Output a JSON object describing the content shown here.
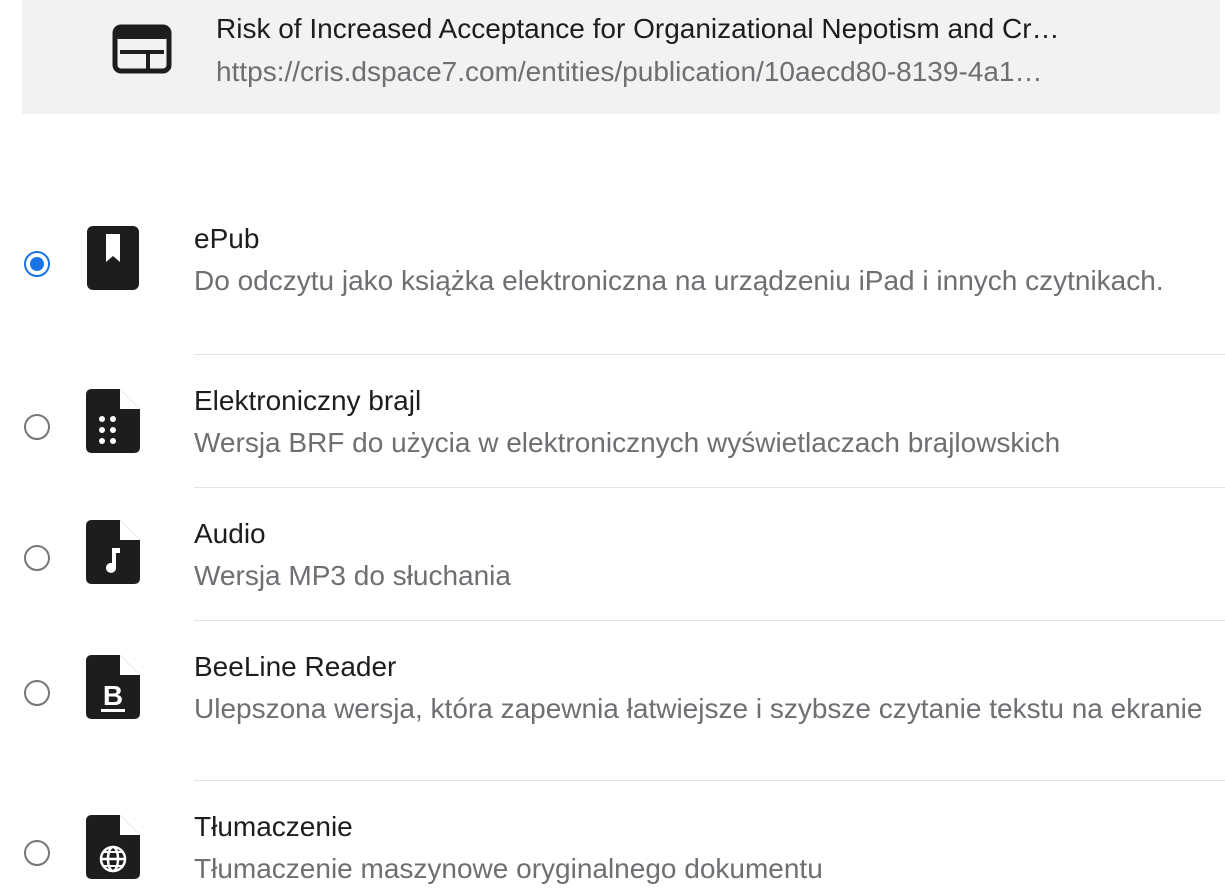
{
  "source": {
    "title": "Risk of Increased Acceptance for Organizational Nepotism and Cr…",
    "url": "https://cris.dspace7.com/entities/publication/10aecd80-8139-4a1…",
    "icon": "web-page-icon"
  },
  "accent_color": "#1a73e8",
  "options": [
    {
      "title": "ePub",
      "description": "Do odczytu jako książka elektroniczna na urządzeniu iPad i innych czytnikach.",
      "selected": true,
      "icon": "bookmark-book-icon"
    },
    {
      "title": "Elektroniczny brajl",
      "description": "Wersja BRF do użycia w elektronicznych wyświetlaczach brajlowskich",
      "selected": false,
      "icon": "braille-file-icon"
    },
    {
      "title": "Audio",
      "description": "Wersja MP3 do słuchania",
      "selected": false,
      "icon": "audio-file-icon"
    },
    {
      "title": "BeeLine Reader",
      "description": "Ulepszona wersja, która zapewnia łatwiejsze i szybsze czytanie tekstu na ekranie",
      "selected": false,
      "icon": "beeline-file-icon"
    },
    {
      "title": "Tłumaczenie",
      "description": "Tłumaczenie maszynowe oryginalnego dokumentu",
      "selected": false,
      "icon": "translation-file-icon"
    }
  ]
}
